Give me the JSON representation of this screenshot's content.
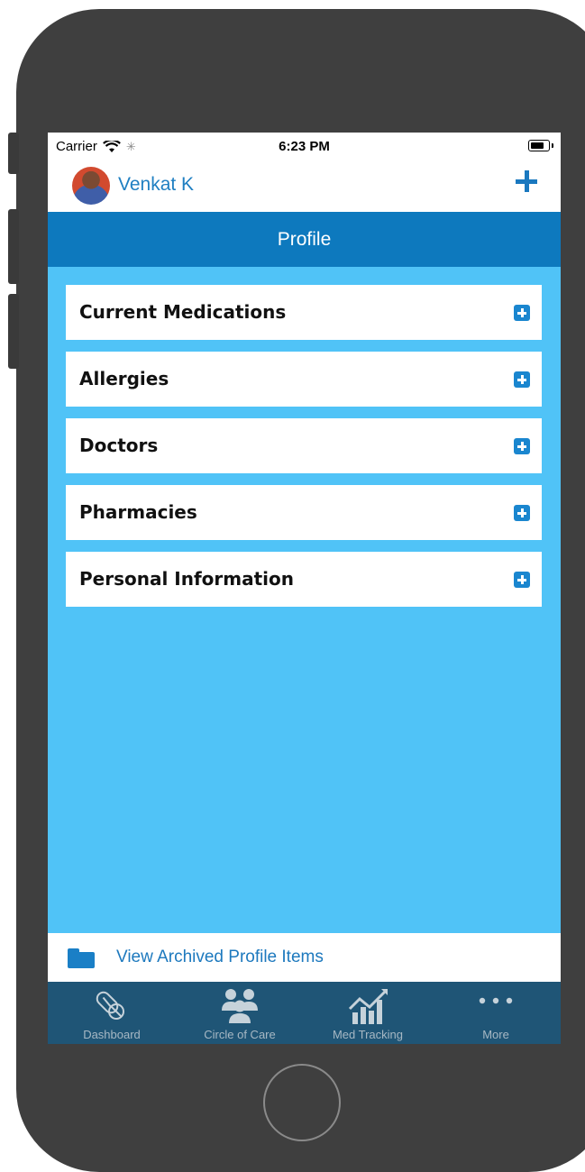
{
  "status_bar": {
    "carrier": "Carrier",
    "time": "6:23 PM"
  },
  "header": {
    "user_name": "Venkat K"
  },
  "title_bar": {
    "title": "Profile"
  },
  "sections": [
    {
      "label": "Current Medications"
    },
    {
      "label": "Allergies"
    },
    {
      "label": "Doctors"
    },
    {
      "label": "Pharmacies"
    },
    {
      "label": "Personal Information"
    }
  ],
  "archived": {
    "label": "View Archived Profile Items"
  },
  "tab_bar": {
    "items": [
      {
        "label": "Dashboard",
        "icon": "pills-icon"
      },
      {
        "label": "Circle of Care",
        "icon": "people-icon"
      },
      {
        "label": "Med Tracking",
        "icon": "chart-icon"
      },
      {
        "label": "More",
        "icon": "ellipsis-icon"
      }
    ]
  },
  "colors": {
    "accent": "#0d79be",
    "background": "#50c3f7",
    "tab_bar": "#1f5576"
  }
}
